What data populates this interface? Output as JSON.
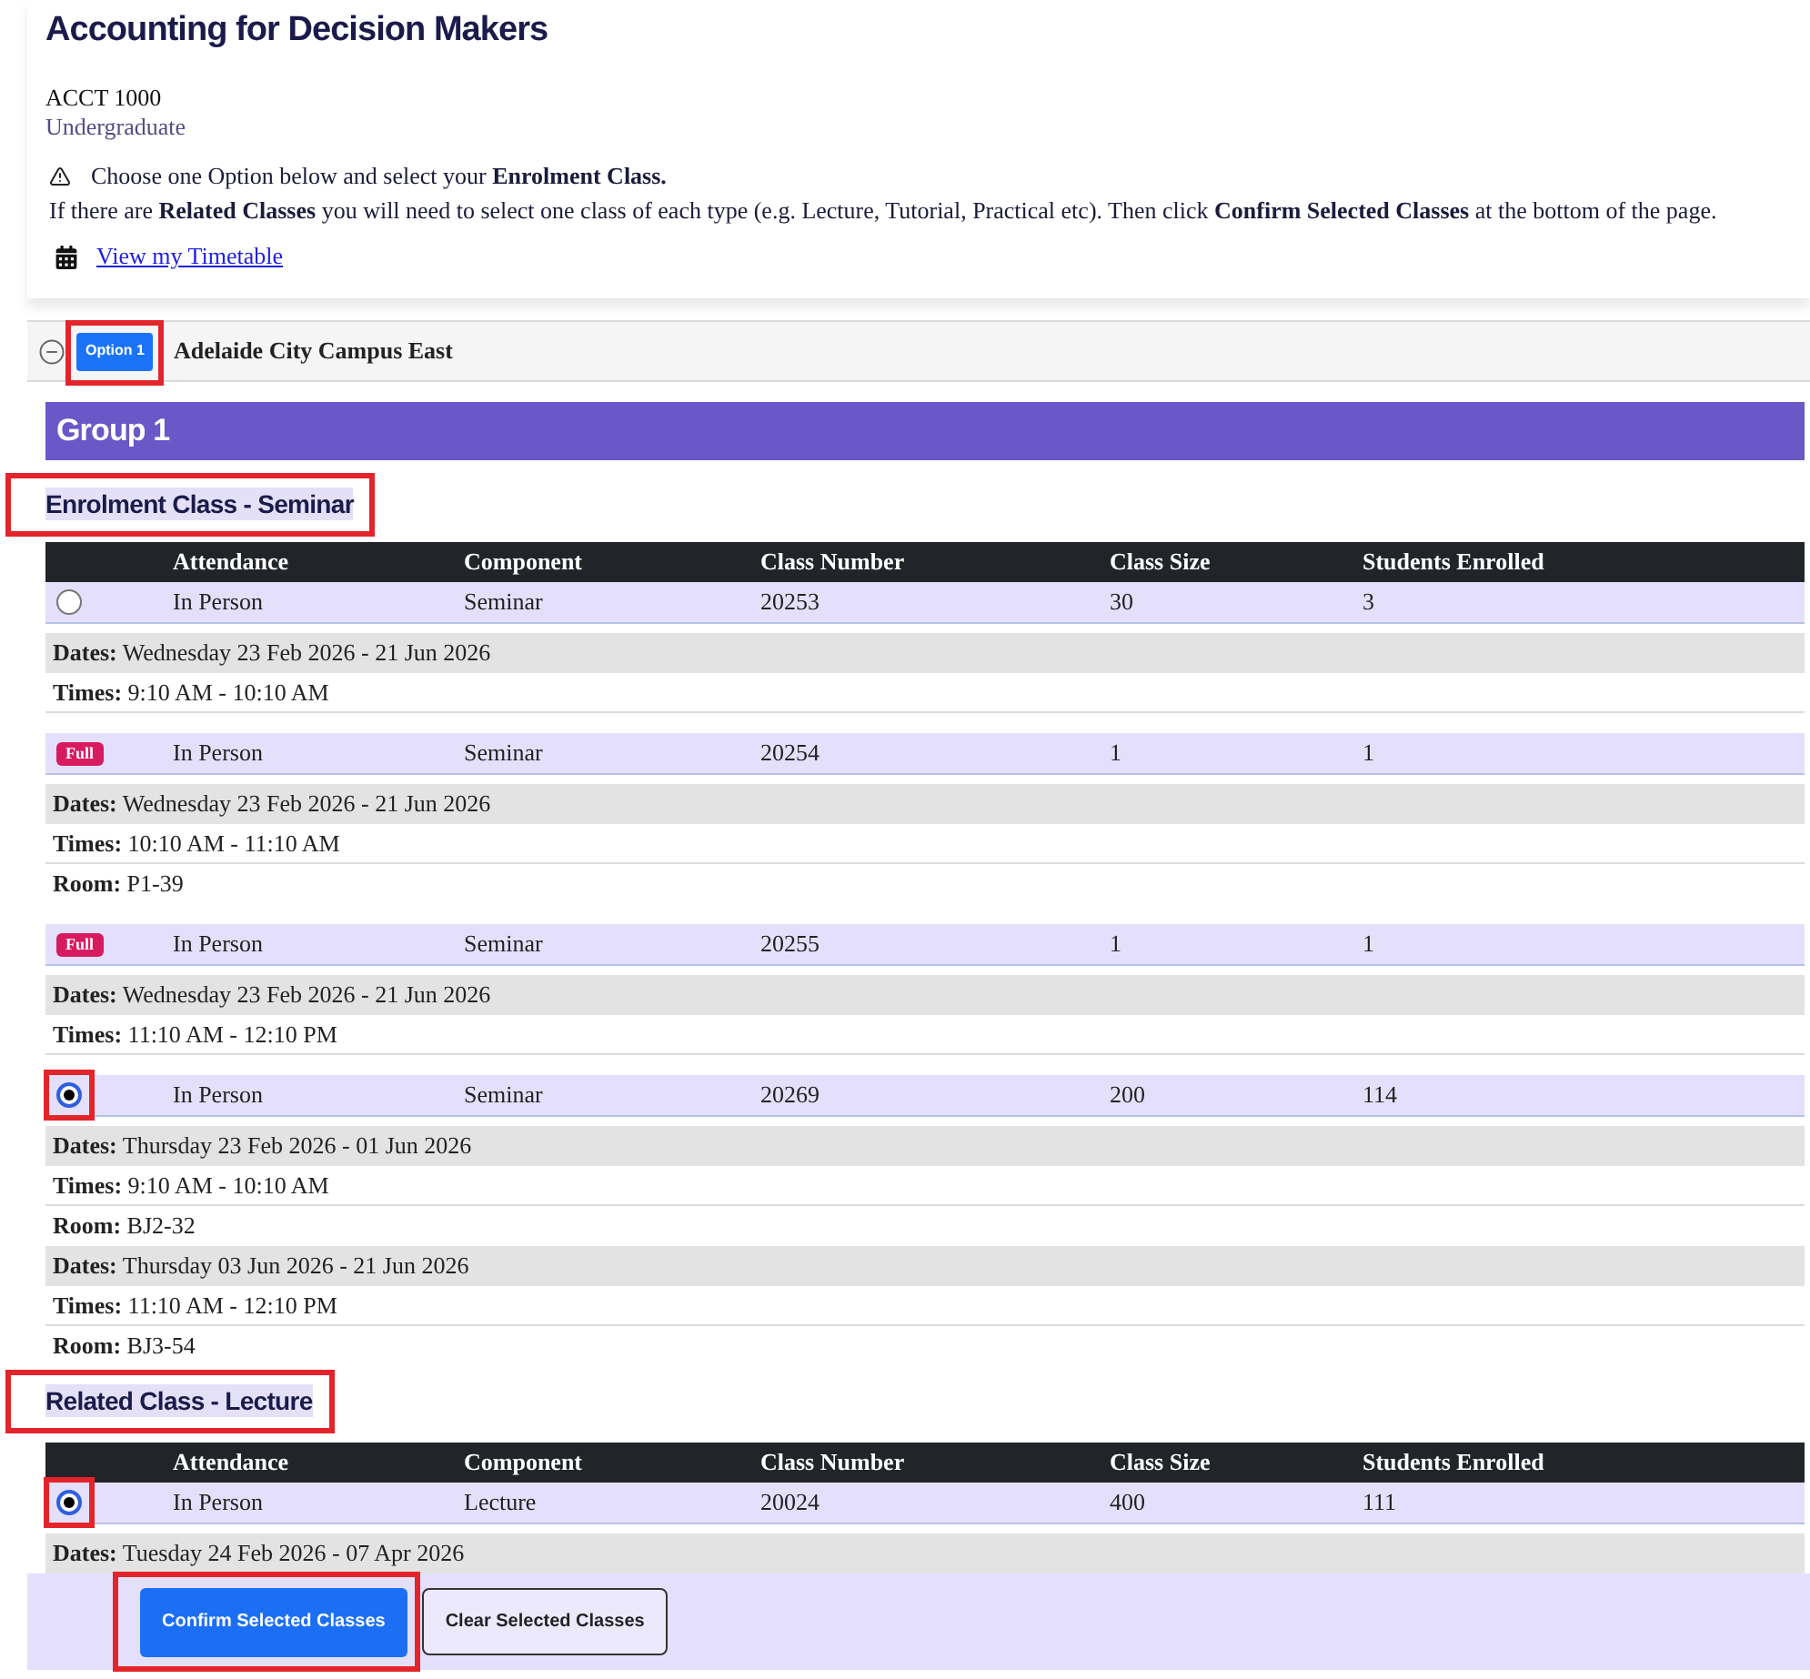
{
  "page": {
    "title": "Accounting for Decision Makers",
    "course_code": "ACCT 1000",
    "career": "Undergraduate"
  },
  "notice": {
    "lines": [
      "Choose one Option below and select your **Enrolment Class.**",
      "If there are **Related Classes** you will need to select one class of each type (e.g. Lecture, Tutorial, Practical etc). Then click **Confirm Selected Classes** at the bottom of the page."
    ]
  },
  "timetable_link": {
    "label": "View my Timetable"
  },
  "option": {
    "badge": "Option 1",
    "campus": "Adelaide City Campus East",
    "expanded": true,
    "highlighted": true
  },
  "groups": [
    {
      "title": "Group 1",
      "sections": [
        {
          "heading": "Enrolment Class - Seminar",
          "highlighted": true,
          "columns": [
            "Attendance",
            "Component",
            "Class Number",
            "Class Size",
            "Students Enrolled"
          ],
          "rows": [
            {
              "kind": "radio",
              "selected": false,
              "highlighted": false,
              "cells": [
                "In Person",
                "Seminar",
                "20253",
                "30",
                "3"
              ],
              "details": [
                {
                  "kind": "dates",
                  "label": "Dates:",
                  "value": "Wednesday 23 Feb 2026 - 21 Jun 2026"
                },
                {
                  "kind": "times",
                  "label": "Times:",
                  "value": "9:10 AM - 10:10 AM"
                }
              ]
            },
            {
              "kind": "full",
              "badge": "Full",
              "highlighted": false,
              "cells": [
                "In Person",
                "Seminar",
                "20254",
                "1",
                "1"
              ],
              "details": [
                {
                  "kind": "dates",
                  "label": "Dates:",
                  "value": "Wednesday 23 Feb 2026 - 21 Jun 2026"
                },
                {
                  "kind": "times",
                  "label": "Times:",
                  "value": "10:10 AM - 11:10 AM"
                },
                {
                  "kind": "room",
                  "label": "Room:",
                  "value": "P1-39"
                }
              ]
            },
            {
              "kind": "full",
              "badge": "Full",
              "highlighted": false,
              "cells": [
                "In Person",
                "Seminar",
                "20255",
                "1",
                "1"
              ],
              "details": [
                {
                  "kind": "dates",
                  "label": "Dates:",
                  "value": "Wednesday 23 Feb 2026 - 21 Jun 2026"
                },
                {
                  "kind": "times",
                  "label": "Times:",
                  "value": "11:10 AM - 12:10 PM"
                }
              ]
            },
            {
              "kind": "radio",
              "selected": true,
              "highlighted": true,
              "cells": [
                "In Person",
                "Seminar",
                "20269",
                "200",
                "114"
              ],
              "details": [
                {
                  "kind": "dates",
                  "label": "Dates:",
                  "value": "Thursday 23 Feb 2026 - 01 Jun 2026"
                },
                {
                  "kind": "times",
                  "label": "Times:",
                  "value": "9:10 AM - 10:10 AM"
                },
                {
                  "kind": "room",
                  "label": "Room:",
                  "value": "BJ2-32"
                },
                {
                  "kind": "dates",
                  "label": "Dates:",
                  "value": "Thursday 03 Jun 2026 - 21 Jun 2026"
                },
                {
                  "kind": "times",
                  "label": "Times:",
                  "value": "11:10 AM - 12:10 PM"
                },
                {
                  "kind": "room",
                  "label": "Room:",
                  "value": "BJ3-54"
                }
              ]
            }
          ]
        },
        {
          "heading": "Related Class - Lecture",
          "highlighted": true,
          "columns": [
            "Attendance",
            "Component",
            "Class Number",
            "Class Size",
            "Students Enrolled"
          ],
          "rows": [
            {
              "kind": "radio",
              "selected": true,
              "highlighted": true,
              "cells": [
                "In Person",
                "Lecture",
                "20024",
                "400",
                "111"
              ],
              "details": [
                {
                  "kind": "dates",
                  "label": "Dates:",
                  "value": "Tuesday 24 Feb 2026 - 07 Apr 2026"
                }
              ]
            }
          ]
        }
      ]
    }
  ],
  "actions": [
    {
      "kind": "primary",
      "label": "Confirm Selected Classes",
      "highlighted": true
    },
    {
      "kind": "secondary",
      "label": "Clear Selected Classes",
      "highlighted": false
    }
  ]
}
